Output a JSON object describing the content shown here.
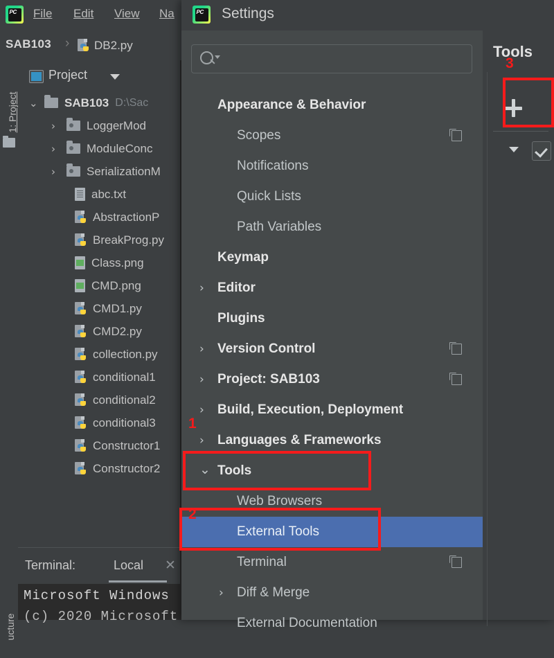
{
  "app": {
    "name": "PyCharm",
    "logo_icon": "pycharm-logo-icon"
  },
  "menubar": {
    "items": [
      {
        "label": "File",
        "mnemonic": "F"
      },
      {
        "label": "Edit",
        "mnemonic": "E"
      },
      {
        "label": "View",
        "mnemonic": "V"
      },
      {
        "label": "Na",
        "mnemonic": "N"
      }
    ]
  },
  "breadcrumb": {
    "project": "SAB103",
    "separator": "›",
    "file": "DB2.py",
    "file_icon": "python-file-icon"
  },
  "toolwindow_tabs": {
    "project_tab": "1: Project",
    "structure_tab": "ucture"
  },
  "project_panel": {
    "header": "Project",
    "header_icon": "project-view-icon",
    "dropdown_icon": "chevron-down-icon",
    "tree": [
      {
        "label": "SAB103",
        "path": "D:\\Sac",
        "type": "root-folder",
        "expanded": true,
        "indent": 0,
        "bold": true
      },
      {
        "label": "LoggerMod",
        "type": "module-folder",
        "expanded": false,
        "indent": 1
      },
      {
        "label": "ModuleConc",
        "type": "module-folder",
        "expanded": false,
        "indent": 1
      },
      {
        "label": "SerializationM",
        "type": "module-folder",
        "expanded": false,
        "indent": 1
      },
      {
        "label": "abc.txt",
        "type": "text-file",
        "indent": 2
      },
      {
        "label": "AbstractionP",
        "type": "python-file",
        "indent": 2
      },
      {
        "label": "BreakProg.py",
        "type": "python-file",
        "indent": 2
      },
      {
        "label": "Class.png",
        "type": "image-file",
        "indent": 2
      },
      {
        "label": "CMD.png",
        "type": "image-file",
        "indent": 2
      },
      {
        "label": "CMD1.py",
        "type": "python-file",
        "indent": 2
      },
      {
        "label": "CMD2.py",
        "type": "python-file",
        "indent": 2
      },
      {
        "label": "collection.py",
        "type": "python-file",
        "indent": 2
      },
      {
        "label": "conditional1",
        "type": "python-file",
        "indent": 2
      },
      {
        "label": "conditional2",
        "type": "python-file",
        "indent": 2
      },
      {
        "label": "conditional3",
        "type": "python-file",
        "indent": 2
      },
      {
        "label": "Constructor1",
        "type": "python-file",
        "indent": 2
      },
      {
        "label": "Constructor2",
        "type": "python-file",
        "indent": 2
      }
    ]
  },
  "terminal": {
    "label": "Terminal:",
    "tab": "Local",
    "close_icon": "close-icon",
    "line1": "Microsoft Windows",
    "line2": "(c) 2020 Microsoft"
  },
  "settings_dialog": {
    "title": "Settings",
    "title_icon": "pycharm-logo-icon",
    "search": {
      "value": "",
      "placeholder": "",
      "icon": "search-icon",
      "dropdown_icon": "caret-down-icon"
    },
    "tree": [
      {
        "label": "Appearance & Behavior",
        "level": "group",
        "arrow": "",
        "copy": false
      },
      {
        "label": "Scopes",
        "level": "leaf",
        "arrow": "",
        "copy": true
      },
      {
        "label": "Notifications",
        "level": "leaf",
        "arrow": "",
        "copy": false
      },
      {
        "label": "Quick Lists",
        "level": "leaf",
        "arrow": "",
        "copy": false
      },
      {
        "label": "Path Variables",
        "level": "leaf",
        "arrow": "",
        "copy": false
      },
      {
        "label": "Keymap",
        "level": "group",
        "arrow": "",
        "copy": false
      },
      {
        "label": "Editor",
        "level": "group",
        "arrow": "›",
        "copy": false
      },
      {
        "label": "Plugins",
        "level": "group",
        "arrow": "",
        "copy": false
      },
      {
        "label": "Version Control",
        "level": "group",
        "arrow": "›",
        "copy": true
      },
      {
        "label": "Project: SAB103",
        "level": "group",
        "arrow": "›",
        "copy": true
      },
      {
        "label": "Build, Execution, Deployment",
        "level": "group",
        "arrow": "›",
        "copy": false
      },
      {
        "label": "Languages & Frameworks",
        "level": "group",
        "arrow": "›",
        "copy": false
      },
      {
        "label": "Tools",
        "level": "group",
        "arrow": "⌄",
        "copy": false,
        "expanded": true
      },
      {
        "label": "Web Browsers",
        "level": "leaf",
        "arrow": "",
        "copy": false
      },
      {
        "label": "External Tools",
        "level": "leaf",
        "arrow": "",
        "copy": false,
        "selected": true
      },
      {
        "label": "Terminal",
        "level": "leaf",
        "arrow": "",
        "copy": true
      },
      {
        "label": "Diff & Merge",
        "level": "leaf",
        "arrow": "›",
        "copy": false
      },
      {
        "label": "External Documentation",
        "level": "leaf",
        "arrow": "",
        "copy": false
      }
    ],
    "right_pane": {
      "title": "Tools",
      "add_label": "+",
      "add_icon": "plus-icon",
      "dropdown_icon": "caret-down-icon",
      "checkbox_icon": "checkmark-icon"
    }
  },
  "annotations": {
    "accent_color": "#f51b1b",
    "markers": [
      {
        "number": "1",
        "target": "Tools"
      },
      {
        "number": "2",
        "target": "External Tools"
      },
      {
        "number": "3",
        "target": "Add (+) button"
      }
    ]
  },
  "colors": {
    "ide_bg": "#3c3f41",
    "dialog_bg": "#45494a",
    "selection_blue": "#4b6eaf",
    "editor_bg": "#2b2b2b",
    "annotation_red": "#f51b1b"
  }
}
